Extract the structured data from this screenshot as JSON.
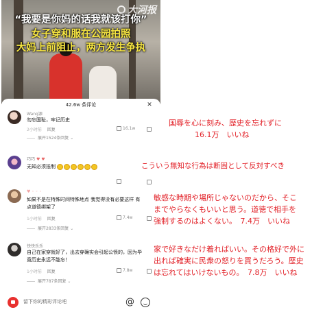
{
  "video": {
    "watermark": "大河报",
    "quote_line": "“我要是你妈的话我就该打你”",
    "headline_1": "女子穿和服在公园拍照",
    "headline_2": "大妈上前阻止，两方发生争执"
  },
  "sheet": {
    "title": "42.6w 条评论",
    "close_glyph": "✕"
  },
  "comments": [
    {
      "username": "Wang源",
      "text": "勿忘国耻，牢记历史",
      "time": "2小时前",
      "reply": "回复",
      "likes": "16.1w",
      "expand": "展开1524条回复"
    },
    {
      "username": "巧巧",
      "text": "无知必须抵制",
      "time": "",
      "reply": "",
      "likes": "",
      "expand": ""
    },
    {
      "username": "",
      "text": "如果不是在特殊时间特殊地点 我觉得没有必要这样 有点道德绑架了",
      "time": "1小时前",
      "reply": "回复",
      "likes": "7.4w",
      "expand": "展开2833条回复"
    },
    {
      "username": "快快乐乐",
      "text": "自己在家穿就好了，出去穿确实会引起公愤的，因为毕竟历史永远不能忘！",
      "time": "1小时前",
      "reply": "回复",
      "likes": "7.8w",
      "expand": "展开787条回复"
    }
  ],
  "input": {
    "placeholder": "留下你的精彩评论吧",
    "at_glyph": "@"
  },
  "translations": [
    {
      "line1": "国辱を心に刻み、歴史を忘れずに",
      "line2": "16.1万　いいね"
    },
    {
      "line1": "こういう無知な行為は断固として反対すべき"
    },
    {
      "line1": "敏感な時期や場所じゃないのだから、そこ",
      "line2": "までやらなくもいいと思う。道徳で相手を",
      "line3": "強制するのはよくない。　7.4万　いいね"
    },
    {
      "line1": "家で好きなだけ着ればいい。その格好で外に",
      "line2": "出れば確実に民衆の怒りを買うだろう。歴史",
      "line3": "は忘れてはいけないもの。　7.8万　いいね"
    }
  ],
  "colors": {
    "translation_red": "#e21f26",
    "headline_yellow": "#f7e642",
    "input_avatar_red": "#e8312f"
  }
}
